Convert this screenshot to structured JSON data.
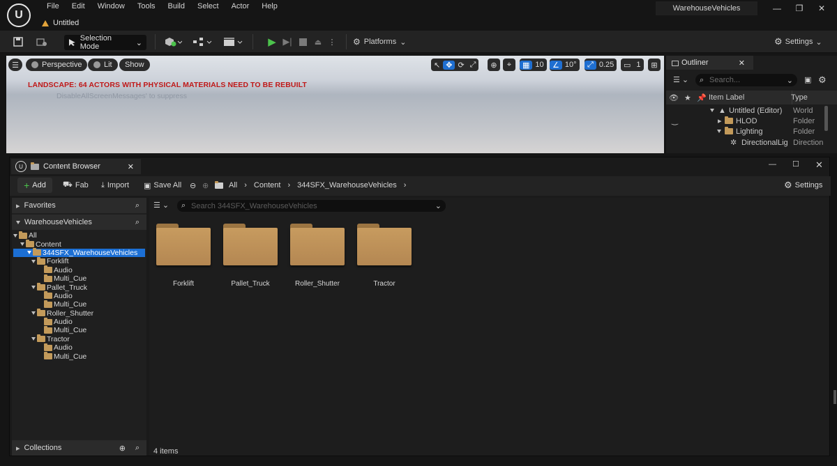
{
  "window": {
    "project_name": "WarehouseVehicles",
    "menu": [
      "File",
      "Edit",
      "Window",
      "Tools",
      "Build",
      "Select",
      "Actor",
      "Help"
    ],
    "doc_tab": "Untitled"
  },
  "toolbar": {
    "selection_mode": "Selection Mode",
    "platforms": "Platforms",
    "settings": "Settings"
  },
  "viewport": {
    "perspective": "Perspective",
    "lit": "Lit",
    "show": "Show",
    "grid_snap": "10",
    "rot_snap": "10°",
    "scale_snap": "0.25",
    "camera_speed": "1",
    "warning": "LANDSCAPE: 64 ACTORS WITH PHYSICAL MATERIALS NEED TO BE REBUILT",
    "suppress": "DisableAllScreenMessages' to suppress"
  },
  "outliner": {
    "title": "Outliner",
    "search_placeholder": "Search...",
    "col_label": "Item Label",
    "col_type": "Type",
    "rows": [
      {
        "label": "Untitled (Editor)",
        "type": "World"
      },
      {
        "label": "HLOD",
        "type": "Folder"
      },
      {
        "label": "Lighting",
        "type": "Folder"
      },
      {
        "label": "DirectionalLigl",
        "type": "Direction"
      }
    ]
  },
  "content_browser": {
    "title": "Content Browser",
    "add": "Add",
    "fab": "Fab",
    "import": "Import",
    "save_all": "Save All",
    "breadcrumb": [
      "All",
      "Content",
      "344SFX_WarehouseVehicles"
    ],
    "settings": "Settings",
    "favorites": "Favorites",
    "project_section": "WarehouseVehicles",
    "collections": "Collections",
    "search_placeholder": "Search 344SFX_WarehouseVehicles",
    "tree": [
      {
        "label": "All"
      },
      {
        "label": "Content"
      },
      {
        "label": "344SFX_WarehouseVehicles"
      },
      {
        "label": "Forklift"
      },
      {
        "label": "Audio"
      },
      {
        "label": "Multi_Cue"
      },
      {
        "label": "Pallet_Truck"
      },
      {
        "label": "Audio"
      },
      {
        "label": "Multi_Cue"
      },
      {
        "label": "Roller_Shutter"
      },
      {
        "label": "Audio"
      },
      {
        "label": "Multi_Cue"
      },
      {
        "label": "Tractor"
      },
      {
        "label": "Audio"
      },
      {
        "label": "Multi_Cue"
      }
    ],
    "folders": [
      "Forklift",
      "Pallet_Truck",
      "Roller_Shutter",
      "Tractor"
    ],
    "item_count": "4 items"
  },
  "colors": {
    "accent": "#1c6fd4",
    "warning": "#c01818",
    "folder": "#c39a5a",
    "play": "#4cc34c"
  }
}
